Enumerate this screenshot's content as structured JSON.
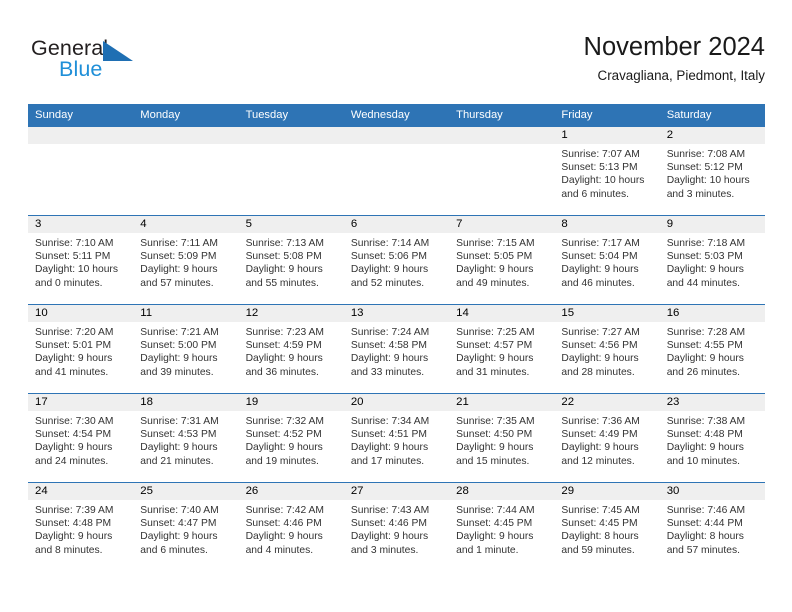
{
  "brand": {
    "name_part1": "General",
    "name_part2": "Blue",
    "triangle_color": "#1f6fb3",
    "blue_text_color": "#1f8fd8"
  },
  "header": {
    "title": "November 2024",
    "subtitle": "Cravagliana, Piedmont, Italy",
    "accent_color": "#2e74b5"
  },
  "calendar": {
    "weekday_headers": [
      "Sunday",
      "Monday",
      "Tuesday",
      "Wednesday",
      "Thursday",
      "Friday",
      "Saturday"
    ],
    "weeks": [
      [
        {
          "day": "",
          "empty": true,
          "sunrise": "",
          "sunset": "",
          "daylight1": "",
          "daylight2": ""
        },
        {
          "day": "",
          "empty": true,
          "sunrise": "",
          "sunset": "",
          "daylight1": "",
          "daylight2": ""
        },
        {
          "day": "",
          "empty": true,
          "sunrise": "",
          "sunset": "",
          "daylight1": "",
          "daylight2": ""
        },
        {
          "day": "",
          "empty": true,
          "sunrise": "",
          "sunset": "",
          "daylight1": "",
          "daylight2": ""
        },
        {
          "day": "",
          "empty": true,
          "sunrise": "",
          "sunset": "",
          "daylight1": "",
          "daylight2": ""
        },
        {
          "day": "1",
          "sunrise": "Sunrise: 7:07 AM",
          "sunset": "Sunset: 5:13 PM",
          "daylight1": "Daylight: 10 hours",
          "daylight2": "and 6 minutes."
        },
        {
          "day": "2",
          "sunrise": "Sunrise: 7:08 AM",
          "sunset": "Sunset: 5:12 PM",
          "daylight1": "Daylight: 10 hours",
          "daylight2": "and 3 minutes."
        }
      ],
      [
        {
          "day": "3",
          "sunrise": "Sunrise: 7:10 AM",
          "sunset": "Sunset: 5:11 PM",
          "daylight1": "Daylight: 10 hours",
          "daylight2": "and 0 minutes."
        },
        {
          "day": "4",
          "sunrise": "Sunrise: 7:11 AM",
          "sunset": "Sunset: 5:09 PM",
          "daylight1": "Daylight: 9 hours",
          "daylight2": "and 57 minutes."
        },
        {
          "day": "5",
          "sunrise": "Sunrise: 7:13 AM",
          "sunset": "Sunset: 5:08 PM",
          "daylight1": "Daylight: 9 hours",
          "daylight2": "and 55 minutes."
        },
        {
          "day": "6",
          "sunrise": "Sunrise: 7:14 AM",
          "sunset": "Sunset: 5:06 PM",
          "daylight1": "Daylight: 9 hours",
          "daylight2": "and 52 minutes."
        },
        {
          "day": "7",
          "sunrise": "Sunrise: 7:15 AM",
          "sunset": "Sunset: 5:05 PM",
          "daylight1": "Daylight: 9 hours",
          "daylight2": "and 49 minutes."
        },
        {
          "day": "8",
          "sunrise": "Sunrise: 7:17 AM",
          "sunset": "Sunset: 5:04 PM",
          "daylight1": "Daylight: 9 hours",
          "daylight2": "and 46 minutes."
        },
        {
          "day": "9",
          "sunrise": "Sunrise: 7:18 AM",
          "sunset": "Sunset: 5:03 PM",
          "daylight1": "Daylight: 9 hours",
          "daylight2": "and 44 minutes."
        }
      ],
      [
        {
          "day": "10",
          "sunrise": "Sunrise: 7:20 AM",
          "sunset": "Sunset: 5:01 PM",
          "daylight1": "Daylight: 9 hours",
          "daylight2": "and 41 minutes."
        },
        {
          "day": "11",
          "sunrise": "Sunrise: 7:21 AM",
          "sunset": "Sunset: 5:00 PM",
          "daylight1": "Daylight: 9 hours",
          "daylight2": "and 39 minutes."
        },
        {
          "day": "12",
          "sunrise": "Sunrise: 7:23 AM",
          "sunset": "Sunset: 4:59 PM",
          "daylight1": "Daylight: 9 hours",
          "daylight2": "and 36 minutes."
        },
        {
          "day": "13",
          "sunrise": "Sunrise: 7:24 AM",
          "sunset": "Sunset: 4:58 PM",
          "daylight1": "Daylight: 9 hours",
          "daylight2": "and 33 minutes."
        },
        {
          "day": "14",
          "sunrise": "Sunrise: 7:25 AM",
          "sunset": "Sunset: 4:57 PM",
          "daylight1": "Daylight: 9 hours",
          "daylight2": "and 31 minutes."
        },
        {
          "day": "15",
          "sunrise": "Sunrise: 7:27 AM",
          "sunset": "Sunset: 4:56 PM",
          "daylight1": "Daylight: 9 hours",
          "daylight2": "and 28 minutes."
        },
        {
          "day": "16",
          "sunrise": "Sunrise: 7:28 AM",
          "sunset": "Sunset: 4:55 PM",
          "daylight1": "Daylight: 9 hours",
          "daylight2": "and 26 minutes."
        }
      ],
      [
        {
          "day": "17",
          "sunrise": "Sunrise: 7:30 AM",
          "sunset": "Sunset: 4:54 PM",
          "daylight1": "Daylight: 9 hours",
          "daylight2": "and 24 minutes."
        },
        {
          "day": "18",
          "sunrise": "Sunrise: 7:31 AM",
          "sunset": "Sunset: 4:53 PM",
          "daylight1": "Daylight: 9 hours",
          "daylight2": "and 21 minutes."
        },
        {
          "day": "19",
          "sunrise": "Sunrise: 7:32 AM",
          "sunset": "Sunset: 4:52 PM",
          "daylight1": "Daylight: 9 hours",
          "daylight2": "and 19 minutes."
        },
        {
          "day": "20",
          "sunrise": "Sunrise: 7:34 AM",
          "sunset": "Sunset: 4:51 PM",
          "daylight1": "Daylight: 9 hours",
          "daylight2": "and 17 minutes."
        },
        {
          "day": "21",
          "sunrise": "Sunrise: 7:35 AM",
          "sunset": "Sunset: 4:50 PM",
          "daylight1": "Daylight: 9 hours",
          "daylight2": "and 15 minutes."
        },
        {
          "day": "22",
          "sunrise": "Sunrise: 7:36 AM",
          "sunset": "Sunset: 4:49 PM",
          "daylight1": "Daylight: 9 hours",
          "daylight2": "and 12 minutes."
        },
        {
          "day": "23",
          "sunrise": "Sunrise: 7:38 AM",
          "sunset": "Sunset: 4:48 PM",
          "daylight1": "Daylight: 9 hours",
          "daylight2": "and 10 minutes."
        }
      ],
      [
        {
          "day": "24",
          "sunrise": "Sunrise: 7:39 AM",
          "sunset": "Sunset: 4:48 PM",
          "daylight1": "Daylight: 9 hours",
          "daylight2": "and 8 minutes."
        },
        {
          "day": "25",
          "sunrise": "Sunrise: 7:40 AM",
          "sunset": "Sunset: 4:47 PM",
          "daylight1": "Daylight: 9 hours",
          "daylight2": "and 6 minutes."
        },
        {
          "day": "26",
          "sunrise": "Sunrise: 7:42 AM",
          "sunset": "Sunset: 4:46 PM",
          "daylight1": "Daylight: 9 hours",
          "daylight2": "and 4 minutes."
        },
        {
          "day": "27",
          "sunrise": "Sunrise: 7:43 AM",
          "sunset": "Sunset: 4:46 PM",
          "daylight1": "Daylight: 9 hours",
          "daylight2": "and 3 minutes."
        },
        {
          "day": "28",
          "sunrise": "Sunrise: 7:44 AM",
          "sunset": "Sunset: 4:45 PM",
          "daylight1": "Daylight: 9 hours",
          "daylight2": "and 1 minute."
        },
        {
          "day": "29",
          "sunrise": "Sunrise: 7:45 AM",
          "sunset": "Sunset: 4:45 PM",
          "daylight1": "Daylight: 8 hours",
          "daylight2": "and 59 minutes."
        },
        {
          "day": "30",
          "sunrise": "Sunrise: 7:46 AM",
          "sunset": "Sunset: 4:44 PM",
          "daylight1": "Daylight: 8 hours",
          "daylight2": "and 57 minutes."
        }
      ]
    ]
  }
}
